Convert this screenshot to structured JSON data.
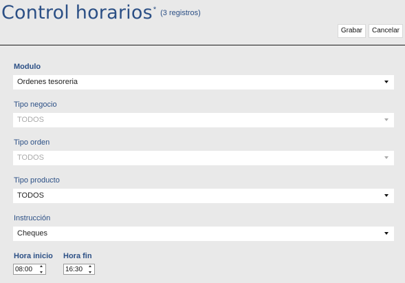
{
  "header": {
    "title": "Control horarios",
    "title_marker": "*",
    "record_count": "(3 registros)"
  },
  "toolbar": {
    "save_label": "Grabar",
    "cancel_label": "Cancelar"
  },
  "form": {
    "modulo": {
      "label": "Modulo",
      "value": "Ordenes tesoreria",
      "enabled": true
    },
    "tipo_negocio": {
      "label": "Tipo negocio",
      "value": "TODOS",
      "enabled": false
    },
    "tipo_orden": {
      "label": "Tipo orden",
      "value": "TODOS",
      "enabled": false
    },
    "tipo_producto": {
      "label": "Tipo producto",
      "value": "TODOS",
      "enabled": true
    },
    "instruccion": {
      "label": "Instrucción",
      "value": "Cheques",
      "enabled": true
    },
    "hora_inicio": {
      "label": "Hora inicio",
      "value": "08:00"
    },
    "hora_fin": {
      "label": "Hora fin",
      "value": "16:30"
    }
  },
  "icons": {
    "dropdown": "chevron-down-icon",
    "spinner_up": "spin-up-icon",
    "spinner_down": "spin-down-icon"
  },
  "colors": {
    "accent": "#2b4f85",
    "background": "#e9e9e9",
    "disabled_text": "#a9a9a9"
  }
}
